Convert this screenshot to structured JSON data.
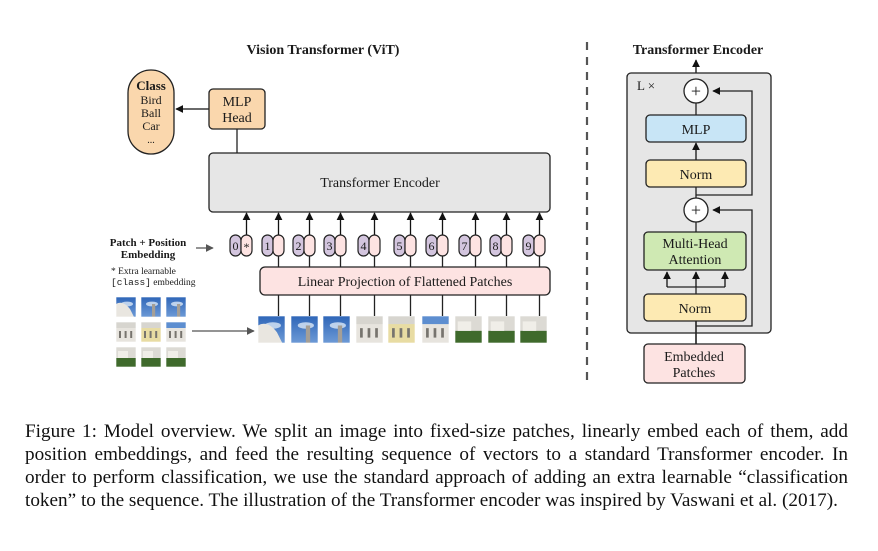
{
  "vit": {
    "title": "Vision Transformer (ViT)",
    "class_box": {
      "heading": "Class",
      "items": [
        "Bird",
        "Ball",
        "Car",
        "..."
      ]
    },
    "mlp_head": [
      "MLP",
      "Head"
    ],
    "encoder_label": "Transformer Encoder",
    "embedding_label": [
      "Patch + Position",
      "Embedding"
    ],
    "extra_note": {
      "line1": "* Extra learnable",
      "mono": "[class]",
      "rest": " embedding"
    },
    "tokens": [
      "0",
      "1",
      "2",
      "3",
      "4",
      "5",
      "6",
      "7",
      "8",
      "9"
    ],
    "class_token_marker": "*",
    "linear_projection": "Linear Projection of Flattened Patches",
    "patch_count": 9
  },
  "encoder": {
    "title": "Transformer Encoder",
    "repeat_label": "L ×",
    "add_symbol": "+",
    "mlp": "MLP",
    "norm_top": "Norm",
    "mha": [
      "Multi-Head",
      "Attention"
    ],
    "norm_bottom": "Norm",
    "input": [
      "Embedded",
      "Patches"
    ]
  },
  "colors": {
    "orange": "#fad7ad",
    "gray_box": "#e6e6e6",
    "pink": "#fde3e2",
    "purple": "#d3c5de",
    "blue": "#c8e5f6",
    "yellow": "#fdeab3",
    "green": "#cfe9b3",
    "sky": "#3f79c4"
  },
  "caption": "Figure 1: Model overview. We split an image into fixed-size patches, linearly embed each of them, add position embeddings, and feed the resulting sequence of vectors to a standard Transformer encoder. In order to perform classification, we use the standard approach of adding an extra learnable “classification token” to the sequence. The illustration of the Transformer encoder was inspired by Vaswani et al. (2017)."
}
